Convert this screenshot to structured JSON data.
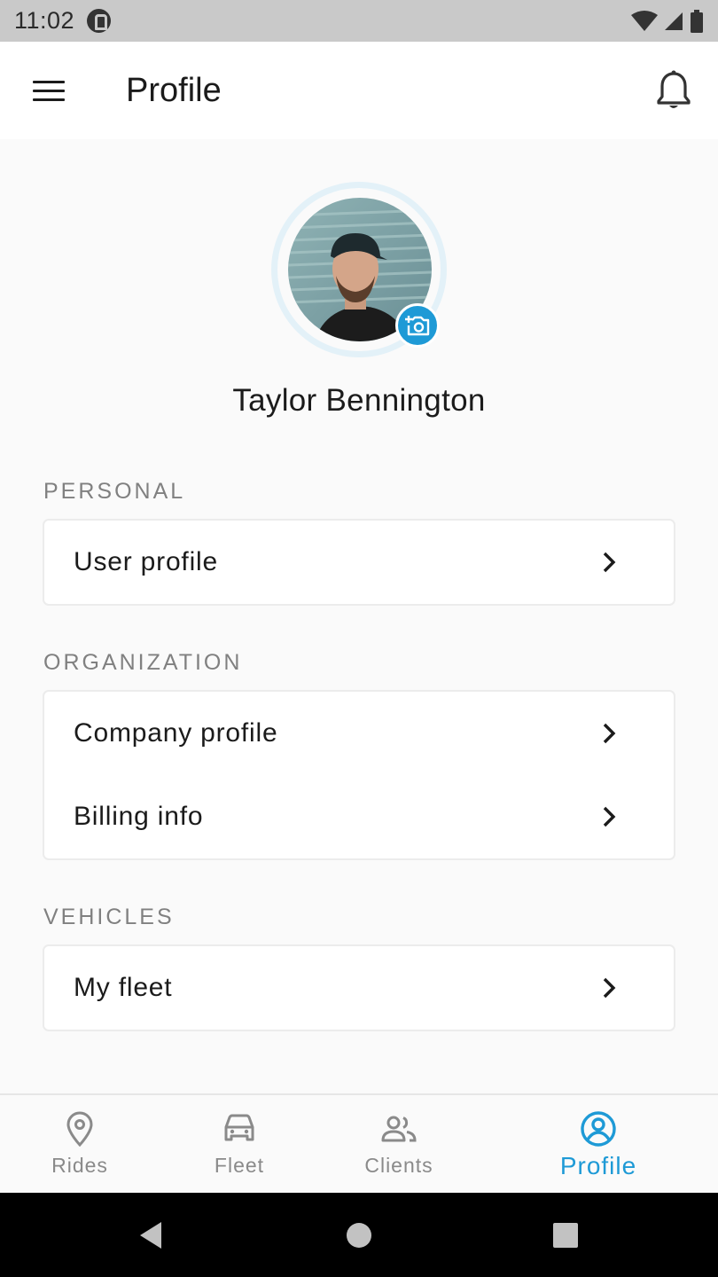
{
  "status_bar": {
    "time": "11:02",
    "icons": [
      "app-notification-icon",
      "wifi-icon",
      "cellular-signal-icon",
      "battery-icon"
    ]
  },
  "app_bar": {
    "title": "Profile",
    "menu_icon": "hamburger-menu-icon",
    "notification_icon": "bell-icon"
  },
  "profile": {
    "name": "Taylor Bennington",
    "avatar_icon": "user-avatar-photo",
    "camera_icon": "add-photo-camera-icon"
  },
  "sections": {
    "personal": {
      "label": "PERSONAL",
      "items": [
        {
          "label": "User profile"
        }
      ]
    },
    "organization": {
      "label": "ORGANIZATION",
      "items": [
        {
          "label": "Company profile"
        },
        {
          "label": "Billing info"
        }
      ]
    },
    "vehicles": {
      "label": "VEHICLES",
      "items": [
        {
          "label": "My fleet"
        }
      ]
    }
  },
  "bottom_nav": {
    "items": [
      {
        "label": "Rides",
        "icon": "map-pin-icon"
      },
      {
        "label": "Fleet",
        "icon": "car-icon"
      },
      {
        "label": "Clients",
        "icon": "people-icon"
      },
      {
        "label": "Profile",
        "icon": "account-circle-icon",
        "active": true
      }
    ]
  },
  "colors": {
    "accent": "#1e9ad6",
    "background": "#fafafa",
    "text": "#1b1b1b",
    "section_label": "#808080"
  }
}
